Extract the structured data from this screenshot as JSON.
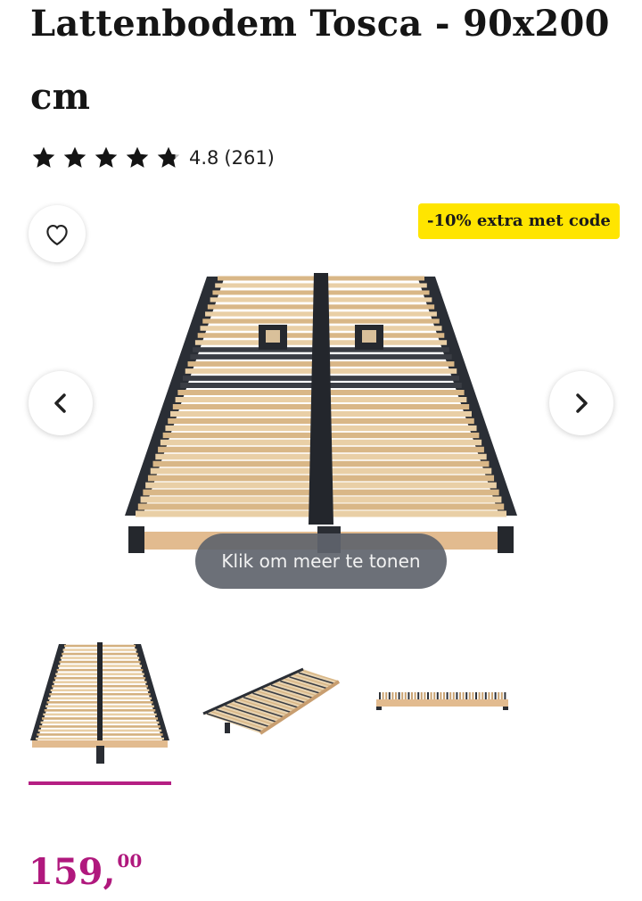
{
  "product": {
    "title": "Lattenbodem Tosca - 90x200 cm"
  },
  "rating": {
    "stars": 4.8,
    "max_stars": 5,
    "score_text": "4.8",
    "count_text": "(261)",
    "star_icon": "star-icon"
  },
  "gallery": {
    "favorite_icon": "heart-outline-icon",
    "promo_badge": "-10% extra met code",
    "prev_icon": "chevron-left-icon",
    "next_icon": "chevron-right-icon",
    "more_label": "Klik om meer te tonen",
    "thumbnail_count": 3,
    "selected_thumbnail": 1
  },
  "price": {
    "whole": "159,",
    "cents": "00"
  },
  "colors": {
    "accent": "#b0187d",
    "badge": "#ffe500",
    "pill": "#5f646c",
    "text": "#151515"
  }
}
